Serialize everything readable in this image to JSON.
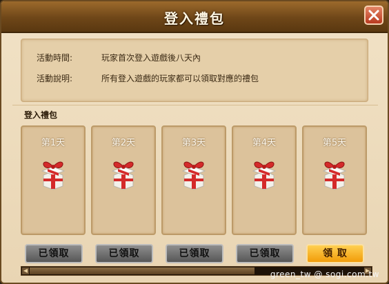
{
  "dialog": {
    "title": "登入禮包",
    "close_label": "×"
  },
  "info": {
    "rows": [
      {
        "label": "活動時間:",
        "value": "玩家首次登入遊戲後八天內"
      },
      {
        "label": "活動說明:",
        "value": "所有登入遊戲的玩家都可以領取對應的禮包"
      }
    ]
  },
  "section_title": "登入禮包",
  "cards": [
    {
      "day": "第1天",
      "icon": "gift-box-icon",
      "button": "已領取",
      "state": "claimed"
    },
    {
      "day": "第2天",
      "icon": "gift-box-icon",
      "button": "已領取",
      "state": "claimed"
    },
    {
      "day": "第3天",
      "icon": "gift-box-icon",
      "button": "已領取",
      "state": "claimed"
    },
    {
      "day": "第4天",
      "icon": "gift-box-icon",
      "button": "已領取",
      "state": "claimed"
    },
    {
      "day": "第5天",
      "icon": "gift-box-icon",
      "button": "領 取",
      "state": "available"
    }
  ],
  "watermark": "green_tw  @ sogi.com.tw",
  "colors": {
    "claimed_button": "#6f6f6f",
    "available_button": "#f6b024",
    "title_bar": "#7a4f1e",
    "gift_red": "#d42a2a"
  }
}
